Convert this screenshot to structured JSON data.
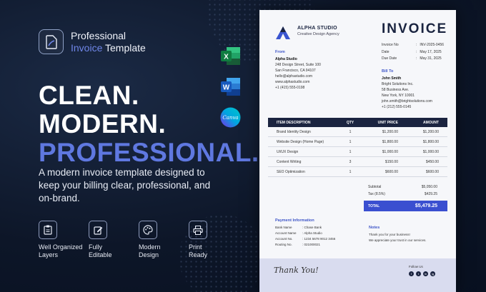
{
  "brand": {
    "line1": "Professional",
    "accent": "Invoice",
    "line2": "Template"
  },
  "headline": {
    "line1": "CLEAN.",
    "line2": "MODERN.",
    "line3": "PROFESSIONAL."
  },
  "tagline": "A modern invoice template designed to keep your billing clear, professional, and on-brand.",
  "features": [
    {
      "icon": "clipboard-icon",
      "line1": "Well Organized",
      "line2": "Layers"
    },
    {
      "icon": "edit-icon",
      "line1": "Fully",
      "line2": "Editable"
    },
    {
      "icon": "palette-icon",
      "line1": "Modern",
      "line2": "Design"
    },
    {
      "icon": "printer-icon",
      "line1": "Print",
      "line2": "Ready"
    }
  ],
  "apps": {
    "excel": "X",
    "word": "W",
    "canva": "Canva"
  },
  "colors": {
    "accent": "#5f78e0",
    "navy": "#1b2440",
    "background": "#0d1628",
    "total_bar": "#3a4fd0"
  },
  "invoice": {
    "studio": "ALPHA STUDIO",
    "studio_sub": "Creative Design Agency",
    "title": "INVOICE",
    "meta": [
      {
        "k": "Invoice No",
        "v": "INV-2025-0456"
      },
      {
        "k": "Date",
        "v": "May 17, 2025"
      },
      {
        "k": "Due Date",
        "v": "May 31, 2025"
      }
    ],
    "from": {
      "heading": "From",
      "name": "Alpha Studio",
      "lines": [
        "248 Design Street, Suite 100",
        "San Francisco, CA 94107",
        "hello@alphastudio.com",
        "www.alphastudio.com",
        "+1 (415) 555-0198"
      ]
    },
    "bill_to": {
      "heading": "Bill To",
      "name": "John Smith",
      "lines": [
        "Bright Solutions Inc.",
        "58 Business Ave.",
        "New York, NY 10001",
        "john.smith@brightsolutions.com",
        "+1 (212) 555-0145"
      ]
    },
    "table": {
      "headers": [
        "ITEM DESCRIPTION",
        "QTY",
        "UNIT PRICE",
        "AMOUNT"
      ],
      "rows": [
        [
          "Brand Identity Design",
          "1",
          "$1,200.00",
          "$1,200.00"
        ],
        [
          "Website Design (Home Page)",
          "1",
          "$1,800.00",
          "$1,800.00"
        ],
        [
          "UI/UX Design",
          "1",
          "$1,000.00",
          "$1,000.00"
        ],
        [
          "Content Writing",
          "3",
          "$150.00",
          "$450.00"
        ],
        [
          "SEO Optimization",
          "1",
          "$600.00",
          "$600.00"
        ]
      ]
    },
    "subtotal_label": "Subtotal",
    "subtotal": "$5,050.00",
    "tax_label": "Tax (8.5%)",
    "tax": "$429.25",
    "total_label": "TOTAL",
    "total": "$5,479.25",
    "payment": {
      "heading": "Payment Information",
      "rows": [
        {
          "k": "Bank Name",
          "v": "Chase Bank"
        },
        {
          "k": "Account Name",
          "v": "Alpha Studio"
        },
        {
          "k": "Account No.",
          "v": "1234 5678 9012 3456"
        },
        {
          "k": "Routing No.",
          "v": "021000021"
        }
      ]
    },
    "notes": {
      "heading": "Notes",
      "lines": [
        "Thank you for your business!",
        "We appreciate your trust in our services."
      ]
    },
    "signature": "Thank You!",
    "follow": "Follow Us",
    "social": [
      "f",
      "t",
      "in",
      "ig"
    ]
  }
}
